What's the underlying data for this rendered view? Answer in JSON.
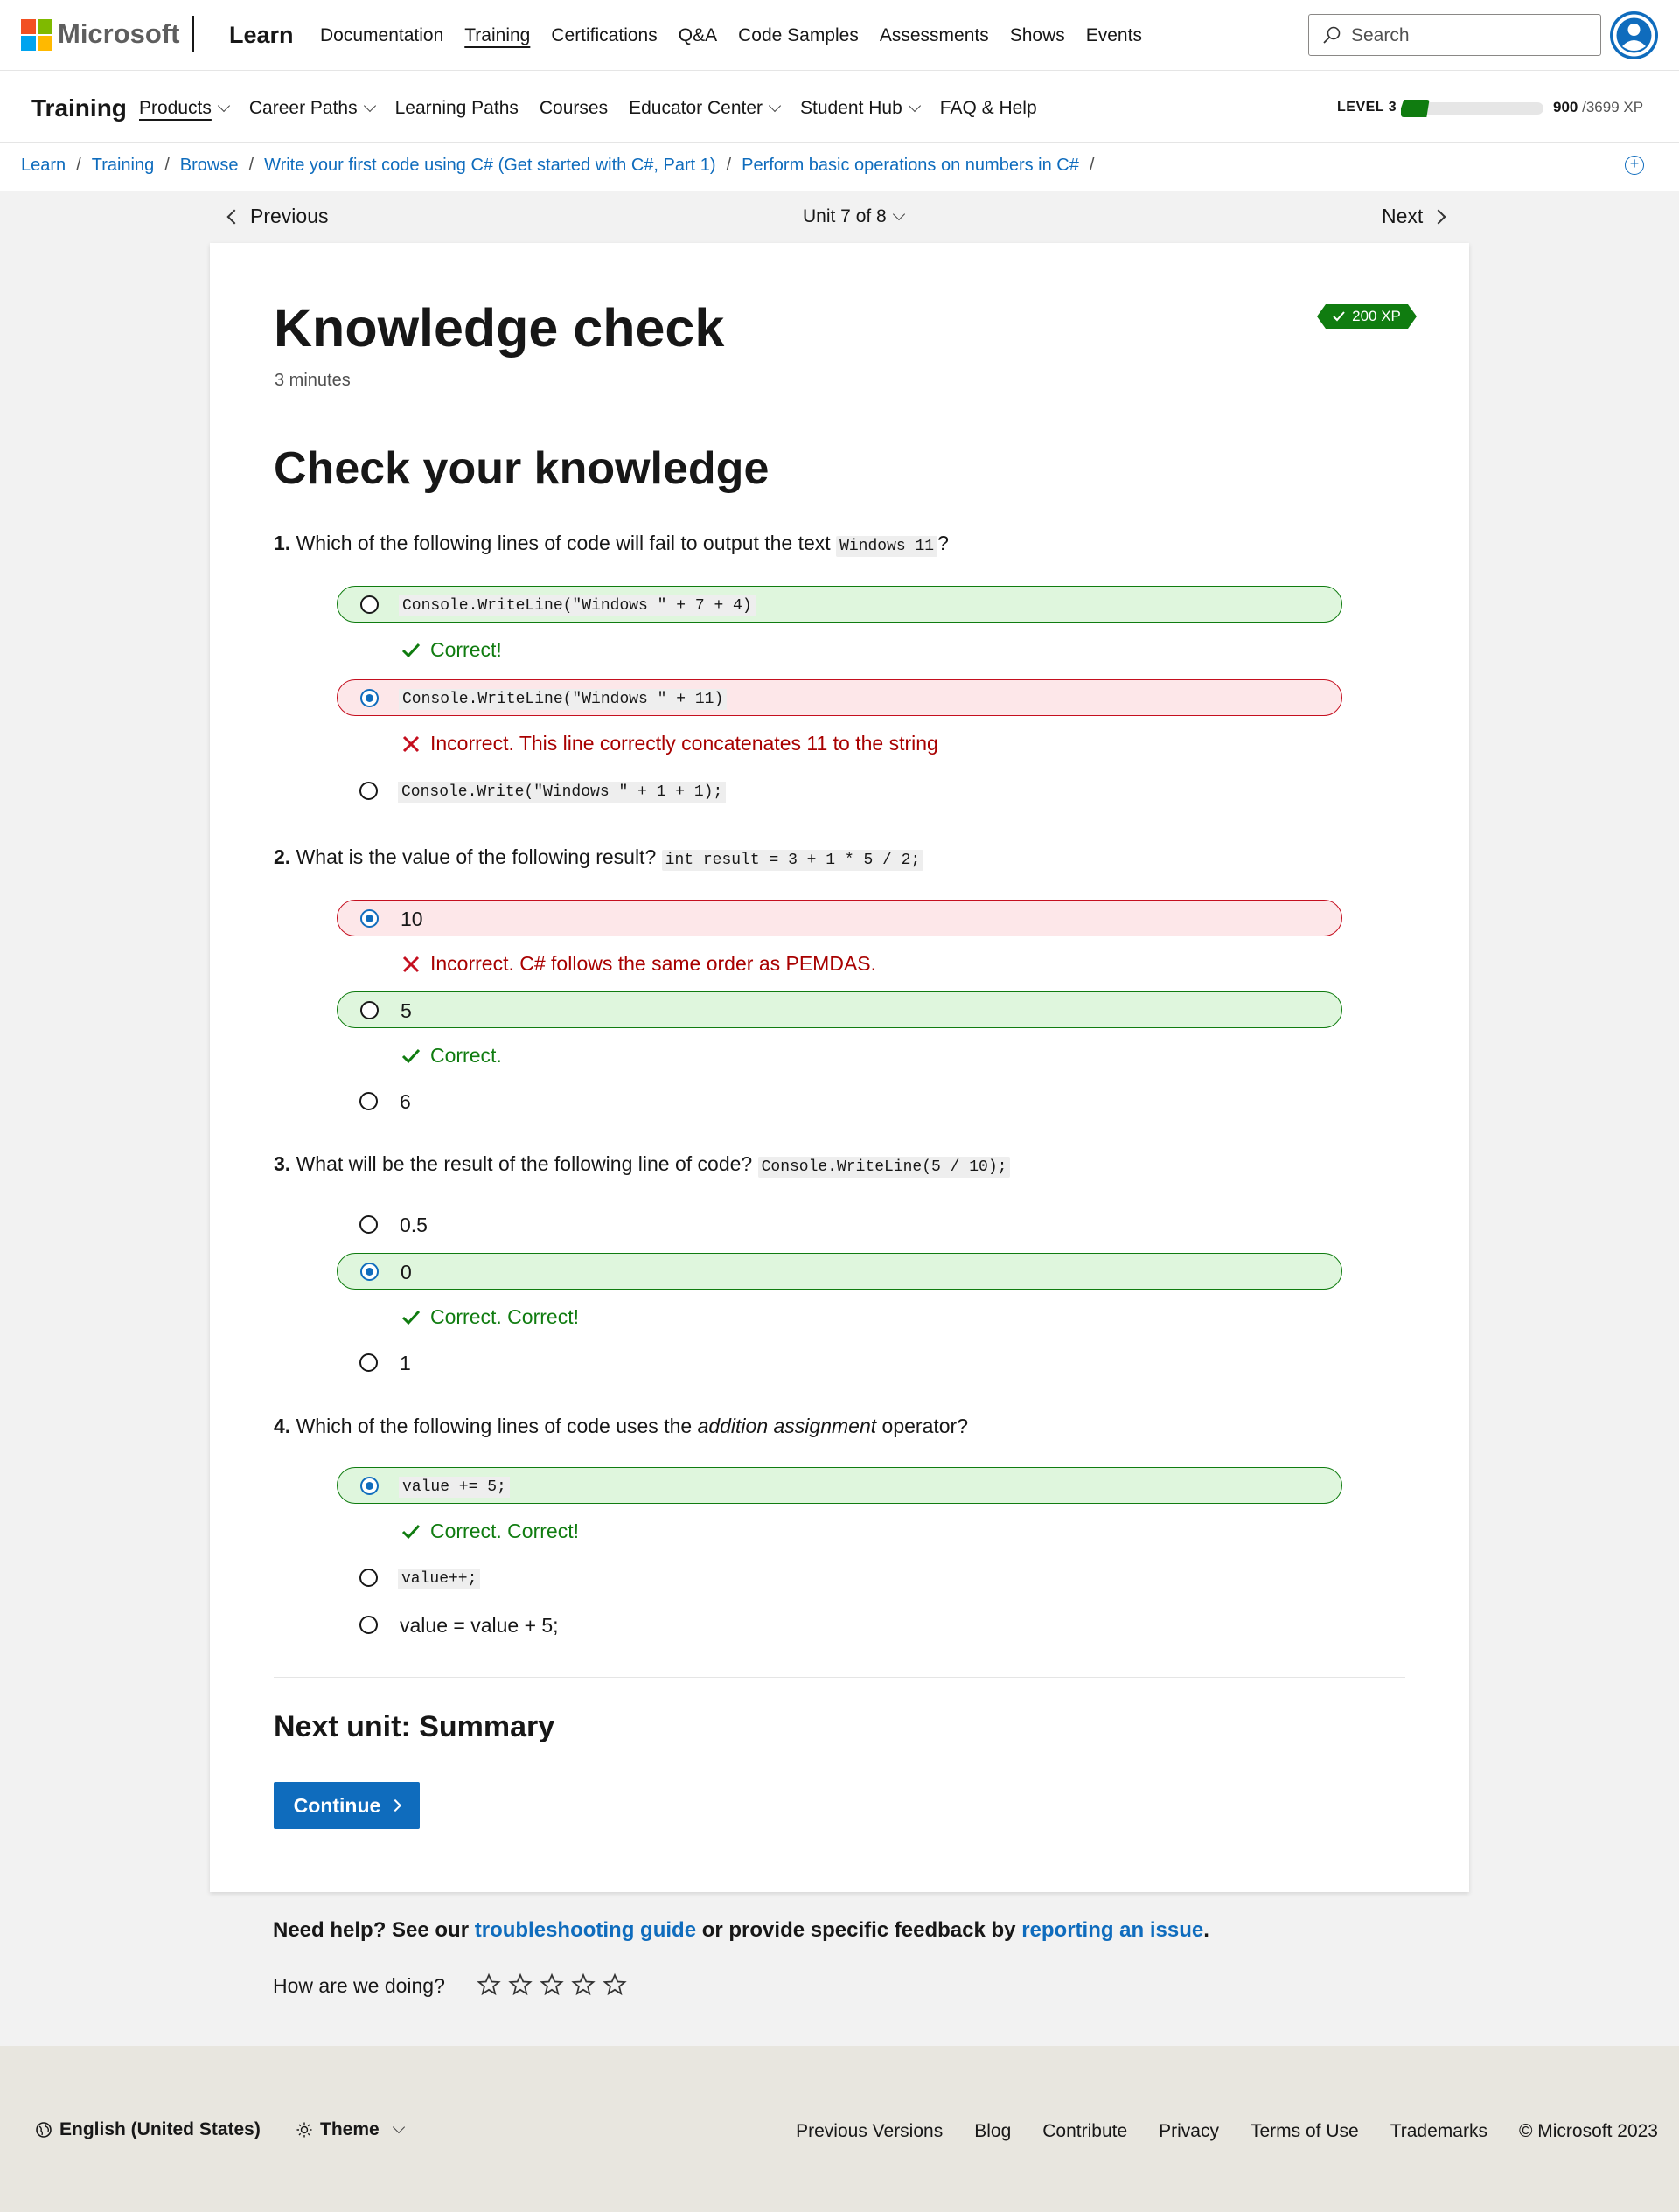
{
  "header": {
    "brand": "Microsoft",
    "product": "Learn",
    "nav": [
      {
        "label": "Documentation",
        "active": false
      },
      {
        "label": "Training",
        "active": true
      },
      {
        "label": "Certifications",
        "active": false
      },
      {
        "label": "Q&A",
        "active": false
      },
      {
        "label": "Code Samples",
        "active": false
      },
      {
        "label": "Assessments",
        "active": false
      },
      {
        "label": "Shows",
        "active": false
      },
      {
        "label": "Events",
        "active": false
      }
    ],
    "search_placeholder": "Search"
  },
  "subheader": {
    "title": "Training",
    "nav": [
      {
        "label": "Products",
        "dropdown": true,
        "active": true
      },
      {
        "label": "Career Paths",
        "dropdown": true,
        "active": false
      },
      {
        "label": "Learning Paths",
        "dropdown": false,
        "active": false
      },
      {
        "label": "Courses",
        "dropdown": false,
        "active": false
      },
      {
        "label": "Educator Center",
        "dropdown": true,
        "active": false
      },
      {
        "label": "Student Hub",
        "dropdown": true,
        "active": false
      },
      {
        "label": "FAQ & Help",
        "dropdown": false,
        "active": false
      }
    ],
    "level_label": "LEVEL 3",
    "xp_current": "900",
    "xp_total": "/3699 XP",
    "level_progress": 0.2
  },
  "breadcrumb": [
    "Learn",
    "Training",
    "Browse",
    "Write your first code using C# (Get started with C#, Part 1)",
    "Perform basic operations on numbers in C#"
  ],
  "unit_nav": {
    "previous": "Previous",
    "counter": "Unit 7 of 8",
    "next": "Next"
  },
  "content": {
    "title": "Knowledge check",
    "duration": "3 minutes",
    "xp_badge": "200 XP",
    "section_title": "Check your knowledge",
    "next_unit_label": "Next unit: Summary",
    "continue_label": "Continue"
  },
  "questions": [
    {
      "number": "1.",
      "text": "Which of the following lines of code will fail to output the text",
      "inline_code": "Windows 11",
      "text_after": "?",
      "options": [
        {
          "label": "Console.WriteLine(\"Windows \" + 7 + 4)",
          "code": true,
          "selected": false,
          "status": "correct",
          "feedback": "Correct!"
        },
        {
          "label": "Console.WriteLine(\"Windows \" + 11)",
          "code": true,
          "selected": true,
          "status": "incorrect",
          "feedback": "Incorrect. This line correctly concatenates 11 to the string"
        },
        {
          "label": "Console.Write(\"Windows \" + 1 + 1);",
          "code": true,
          "selected": false,
          "status": "none",
          "feedback": ""
        }
      ]
    },
    {
      "number": "2.",
      "text": "What is the value of the following result?",
      "inline_code": "int result = 3 + 1 * 5 / 2;",
      "text_after": "",
      "options": [
        {
          "label": "10",
          "code": false,
          "selected": true,
          "status": "incorrect",
          "feedback": "Incorrect. C# follows the same order as PEMDAS."
        },
        {
          "label": "5",
          "code": false,
          "selected": false,
          "status": "correct",
          "feedback": "Correct."
        },
        {
          "label": "6",
          "code": false,
          "selected": false,
          "status": "none",
          "feedback": ""
        }
      ]
    },
    {
      "number": "3.",
      "text": "What will be the result of the following line of code?",
      "inline_code": "Console.WriteLine(5 / 10);",
      "text_after": "",
      "options": [
        {
          "label": "0.5",
          "code": false,
          "selected": false,
          "status": "none",
          "feedback": ""
        },
        {
          "label": "0",
          "code": false,
          "selected": true,
          "status": "correct",
          "feedback": "Correct. Correct!"
        },
        {
          "label": "1",
          "code": false,
          "selected": false,
          "status": "none",
          "feedback": ""
        }
      ]
    },
    {
      "number": "4.",
      "text_before_em": "Which of the following lines of code uses the",
      "em": "addition assignment",
      "text_after_em": "operator?",
      "options": [
        {
          "label": "value += 5;",
          "code": true,
          "selected": true,
          "status": "correct",
          "feedback": "Correct. Correct!"
        },
        {
          "label": "value++;",
          "code": true,
          "selected": false,
          "status": "none",
          "feedback": ""
        },
        {
          "label": "value = value + 5;",
          "code": false,
          "selected": false,
          "status": "none",
          "feedback": ""
        }
      ]
    }
  ],
  "help": {
    "prefix": "Need help? See our",
    "link1": "troubleshooting guide",
    "middle": "or provide specific feedback by",
    "link2": "reporting an issue",
    "suffix": ".",
    "rating_label": "How are we doing?",
    "rating_max": 5
  },
  "footer": {
    "language": "English (United States)",
    "theme": "Theme",
    "links": [
      "Previous Versions",
      "Blog",
      "Contribute",
      "Privacy",
      "Terms of Use",
      "Trademarks",
      "© Microsoft 2023"
    ]
  },
  "colors": {
    "accent": "#0f6cbd",
    "correct": "#107c10",
    "incorrect": "#c50f1f"
  }
}
